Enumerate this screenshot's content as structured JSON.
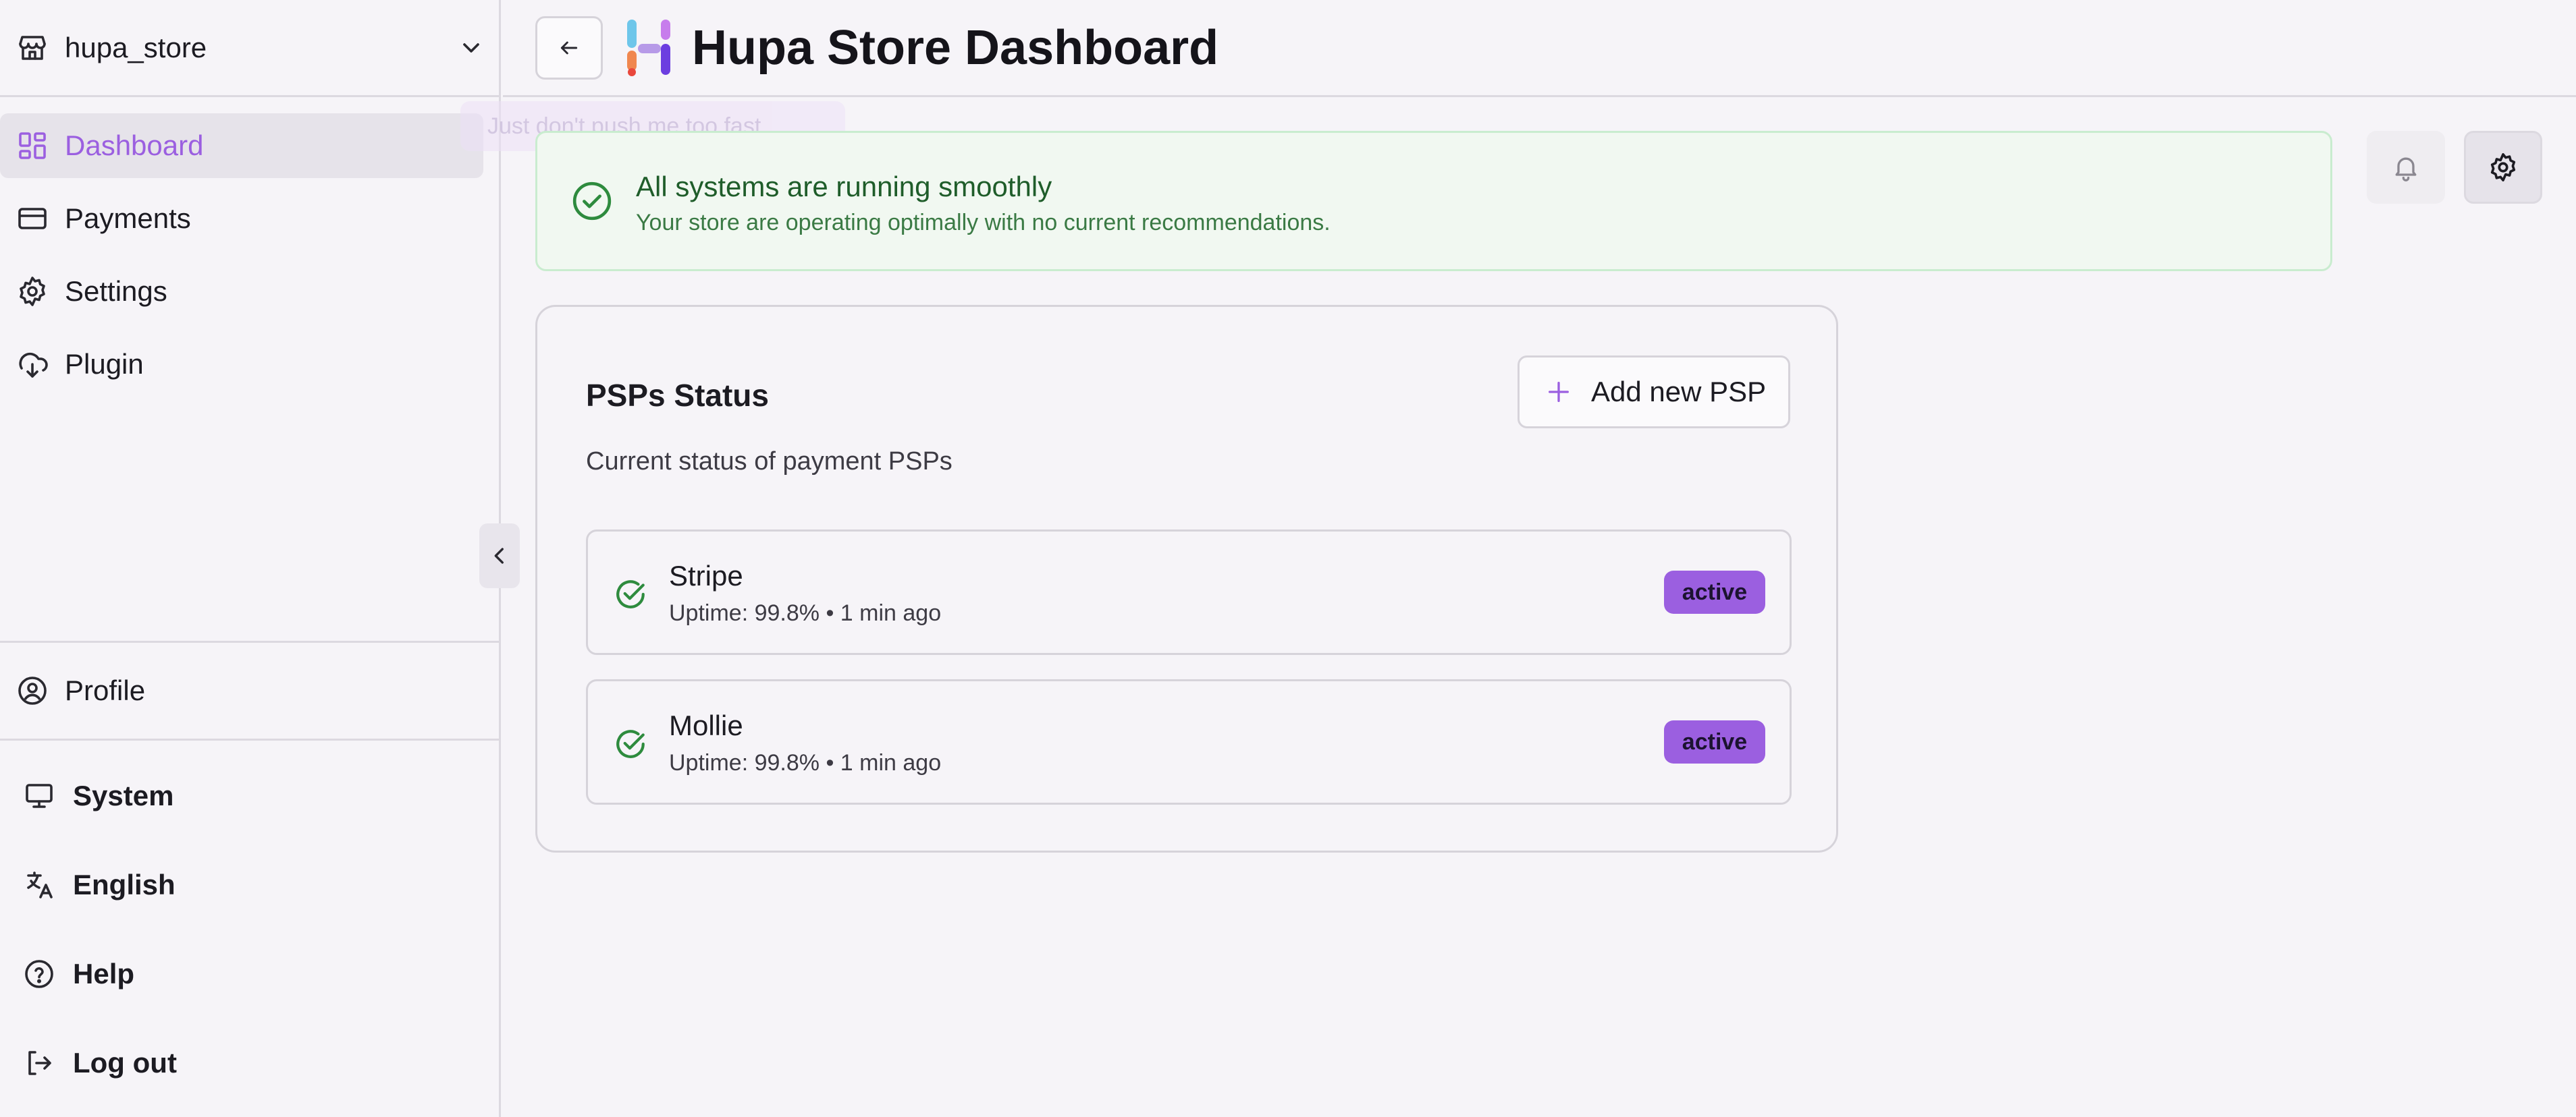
{
  "store": {
    "name": "hupa_store"
  },
  "nav": [
    {
      "label": "Dashboard",
      "icon": "dashboard-icon",
      "active": true
    },
    {
      "label": "Payments",
      "icon": "credit-card-icon"
    },
    {
      "label": "Settings",
      "icon": "gear-icon"
    },
    {
      "label": "Plugin",
      "icon": "plugin-download-icon"
    }
  ],
  "profile": {
    "label": "Profile"
  },
  "bottom_nav": [
    {
      "label": "System",
      "icon": "monitor-icon"
    },
    {
      "label": "English",
      "icon": "translate-icon"
    },
    {
      "label": "Help",
      "icon": "help-circle-icon"
    },
    {
      "label": "Log out",
      "icon": "logout-icon"
    }
  ],
  "header": {
    "title": "Hupa Store Dashboard"
  },
  "toast": {
    "text": "Just don't push me too fast"
  },
  "status_banner": {
    "title": "All systems are running smoothly",
    "subtitle": "Your store are operating optimally with no current recommendations."
  },
  "psp_card": {
    "title": "PSPs Status",
    "description": "Current status of payment PSPs",
    "add_label": "Add new PSP",
    "items": [
      {
        "name": "Stripe",
        "meta": "Uptime: 99.8% • 1 min ago",
        "status": "active"
      },
      {
        "name": "Mollie",
        "meta": "Uptime: 99.8% • 1 min ago",
        "status": "active"
      }
    ]
  },
  "colors": {
    "accent": "#9b5fe0",
    "success": "#2e8b3e",
    "success_bg": "#f1f8f1",
    "border": "#d6d3da"
  }
}
